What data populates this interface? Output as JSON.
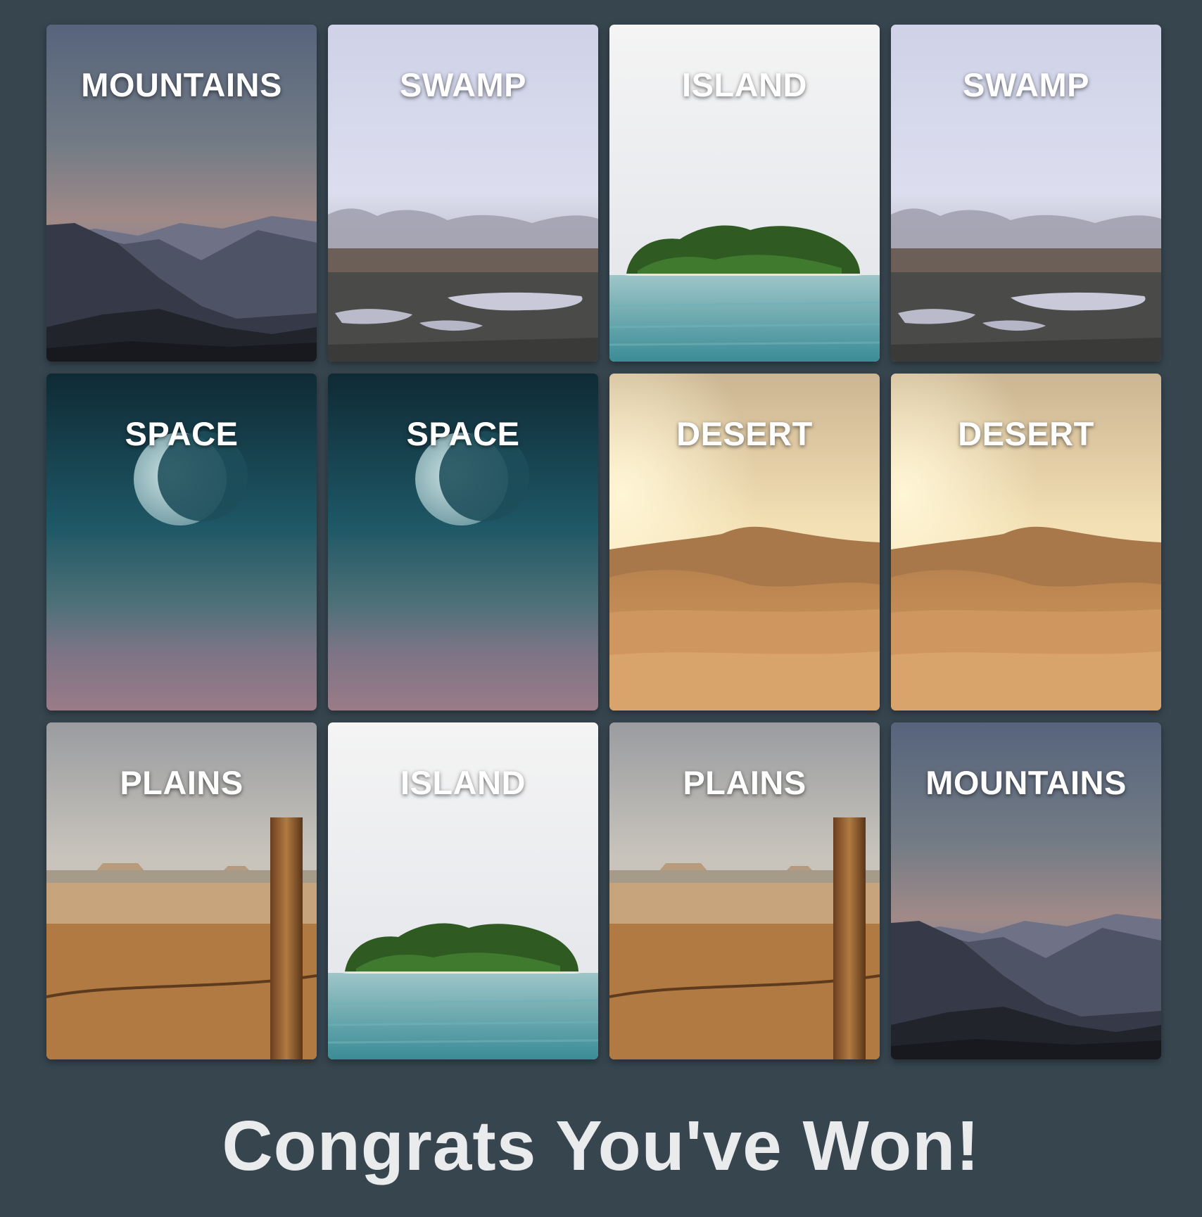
{
  "game": {
    "cards": [
      {
        "label": "MOUNTAINS",
        "theme": "mountains"
      },
      {
        "label": "SWAMP",
        "theme": "swamp"
      },
      {
        "label": "ISLAND",
        "theme": "island"
      },
      {
        "label": "SWAMP",
        "theme": "swamp"
      },
      {
        "label": "SPACE",
        "theme": "space"
      },
      {
        "label": "SPACE",
        "theme": "space"
      },
      {
        "label": "DESERT",
        "theme": "desert"
      },
      {
        "label": "DESERT",
        "theme": "desert"
      },
      {
        "label": "PLAINS",
        "theme": "plains"
      },
      {
        "label": "ISLAND",
        "theme": "island"
      },
      {
        "label": "PLAINS",
        "theme": "plains"
      },
      {
        "label": "MOUNTAINS",
        "theme": "mountains"
      }
    ],
    "message": "Congrats You've Won!"
  },
  "colors": {
    "background": "#37454f",
    "message": "#e9ebec",
    "label": "#ffffff"
  }
}
